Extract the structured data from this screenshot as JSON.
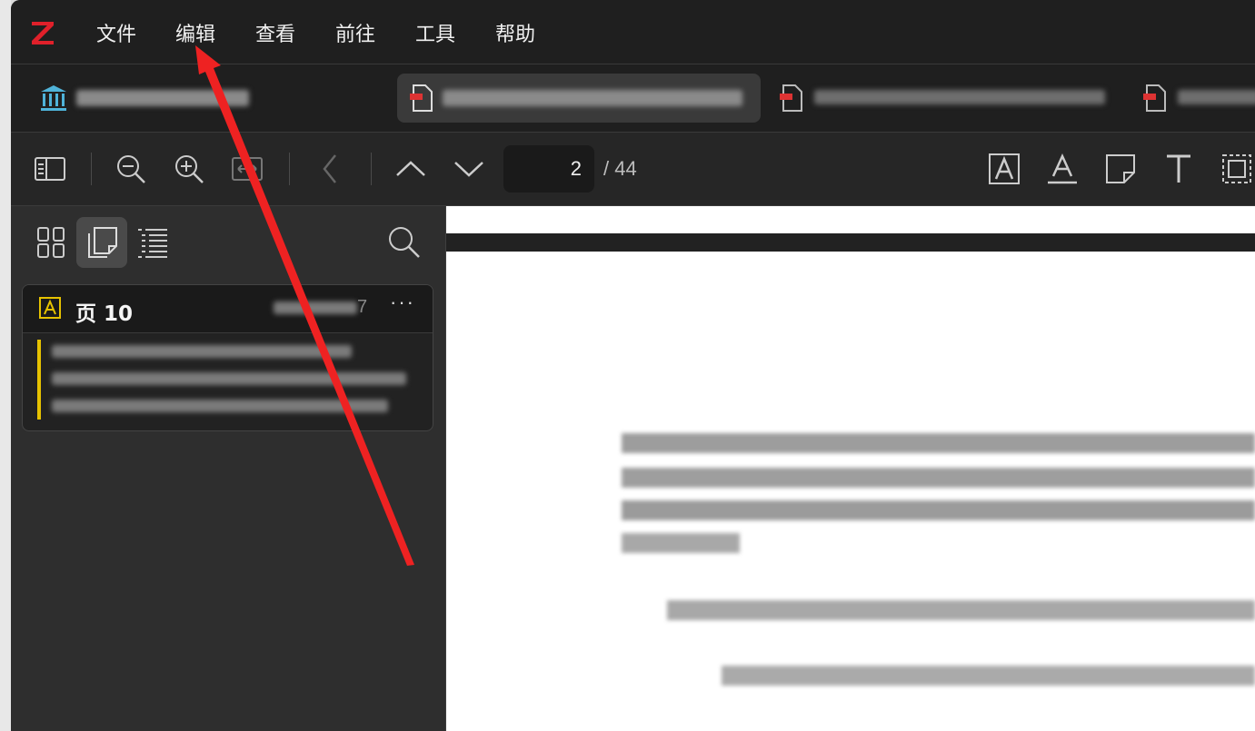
{
  "menubar": {
    "logo": "Z",
    "items": [
      {
        "id": "file",
        "label": "文件"
      },
      {
        "id": "edit",
        "label": "编辑"
      },
      {
        "id": "view",
        "label": "查看"
      },
      {
        "id": "go",
        "label": "前往"
      },
      {
        "id": "tools",
        "label": "工具"
      },
      {
        "id": "help",
        "label": "帮助"
      }
    ]
  },
  "tabs": {
    "library_icon": "library-icon",
    "items": [
      {
        "active": true,
        "icon": "pdf-icon"
      },
      {
        "active": false,
        "icon": "pdf-icon"
      },
      {
        "active": false,
        "icon": "pdf-icon"
      }
    ]
  },
  "toolbar": {
    "page_current": "2",
    "page_total": "/ 44",
    "icons": [
      "sidebar-toggle-icon",
      "zoom-out-icon",
      "zoom-in-icon",
      "fit-width-icon",
      "back-icon",
      "page-up-icon",
      "page-down-icon",
      "highlight-icon",
      "underline-icon",
      "note-icon",
      "text-icon",
      "area-select-icon"
    ]
  },
  "sidebar": {
    "views": [
      "thumbnails-icon",
      "annotations-icon",
      "outline-icon"
    ],
    "search_icon": "search-icon",
    "annotation": {
      "page_label": "页 10",
      "date_tail": "7",
      "more_label": "···",
      "highlight_color": "#e6c200"
    }
  },
  "colors": {
    "logo_red": "#e0202a",
    "arrow_red": "#ee2222",
    "library_teal": "#4fb3d9"
  }
}
